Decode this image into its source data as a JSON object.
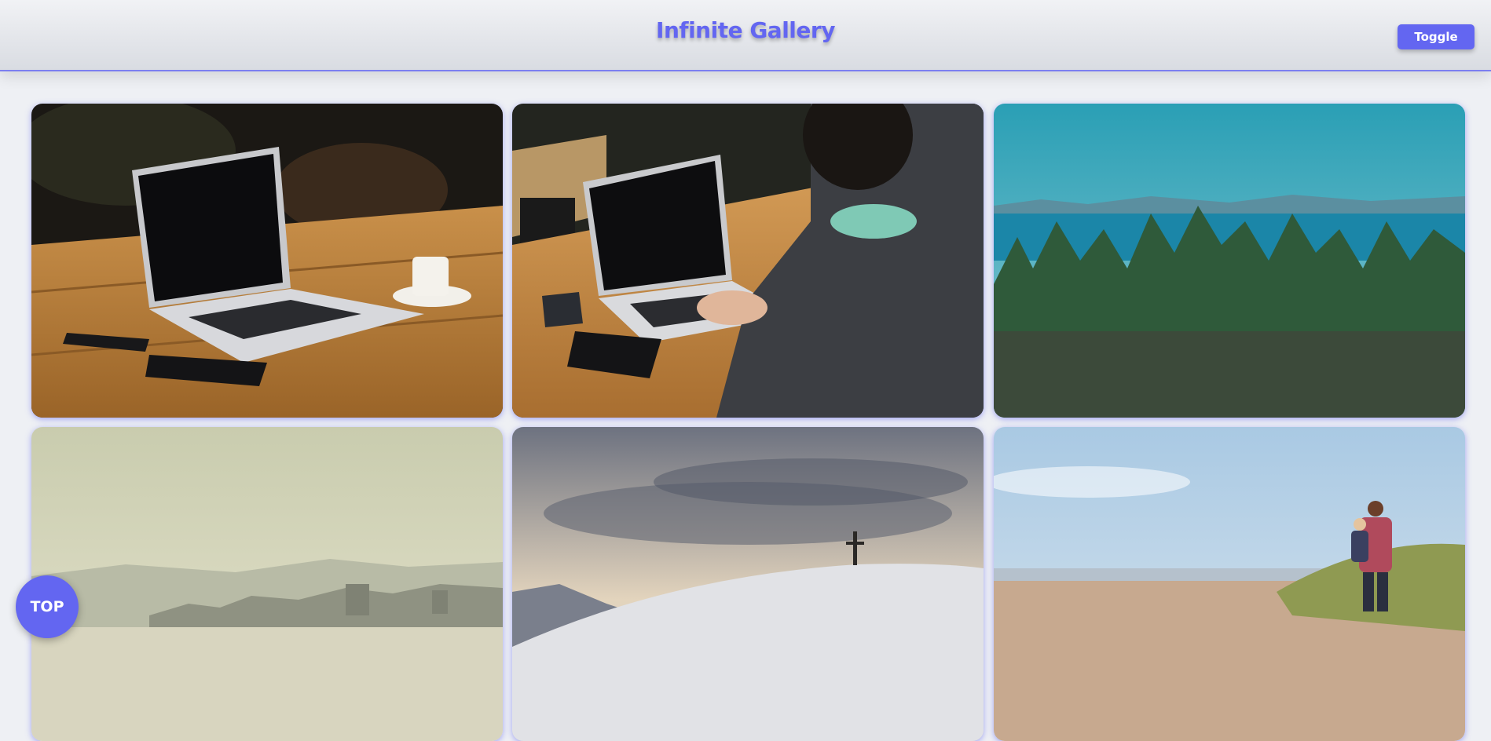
{
  "header": {
    "title": "Infinite Gallery",
    "toggle_label": "Toggle"
  },
  "gallery": {
    "images": [
      {
        "subject": "laptop on wooden table with coffee cup and phone"
      },
      {
        "subject": "person typing on laptop at wooden table"
      },
      {
        "subject": "evergreen forest with blue sea and mountains"
      },
      {
        "subject": "hazy beach with city skyline"
      },
      {
        "subject": "snowy hill with cross under cloudy sky"
      },
      {
        "subject": "man carrying child on beach path"
      }
    ]
  },
  "scroll_top": {
    "label": "TOP"
  },
  "colors": {
    "accent": "#6366f1",
    "background": "#eef0f4"
  }
}
